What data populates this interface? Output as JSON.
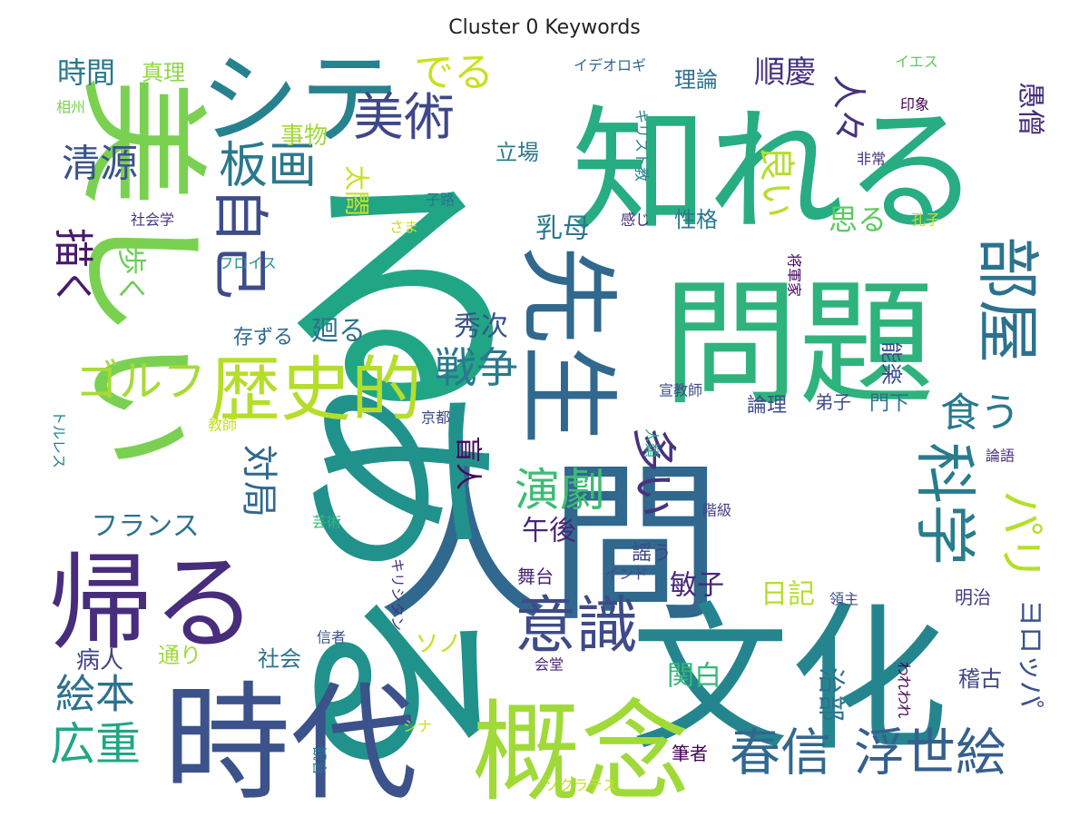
{
  "title": "Cluster 0 Keywords",
  "chart_data": {
    "type": "wordcloud",
    "title": "Cluster 0 Keywords",
    "palette": "viridis",
    "words": [
      {
        "text": "人間",
        "weight": 100,
        "color": "#30688e"
      },
      {
        "text": "る",
        "weight": 96,
        "color": "#21a685"
      },
      {
        "text": "ある",
        "weight": 92,
        "color": "#21918c"
      },
      {
        "text": "文化",
        "weight": 88,
        "color": "#25858e"
      },
      {
        "text": "問題",
        "weight": 86,
        "color": "#2eb37c"
      },
      {
        "text": "知れる",
        "weight": 82,
        "color": "#27ad81"
      },
      {
        "text": "美しい",
        "weight": 80,
        "color": "#7ad151"
      },
      {
        "text": "時代",
        "weight": 76,
        "color": "#3b528b"
      },
      {
        "text": "概念",
        "weight": 72,
        "color": "#a0da39"
      },
      {
        "text": "先生",
        "weight": 66,
        "color": "#31688e"
      },
      {
        "text": "帰る",
        "weight": 64,
        "color": "#472d7b"
      },
      {
        "text": "シテ",
        "weight": 60,
        "color": "#26828e"
      },
      {
        "text": "歴史的",
        "weight": 52,
        "color": "#b5de2b"
      },
      {
        "text": "部屋",
        "weight": 50,
        "color": "#2c728e"
      },
      {
        "text": "科学",
        "weight": 48,
        "color": "#287c8e"
      },
      {
        "text": "意識",
        "weight": 44,
        "color": "#3e4a89"
      },
      {
        "text": "自己",
        "weight": 42,
        "color": "#3e4c8a"
      },
      {
        "text": "春信",
        "weight": 40,
        "color": "#31688e"
      },
      {
        "text": "浮世絵",
        "weight": 40,
        "color": "#355f8d"
      },
      {
        "text": "美術",
        "weight": 40,
        "color": "#3f4788"
      },
      {
        "text": "板画",
        "weight": 38,
        "color": "#2a788e"
      },
      {
        "text": "演劇",
        "weight": 36,
        "color": "#3dbc74"
      },
      {
        "text": "多い",
        "weight": 36,
        "color": "#46337e"
      },
      {
        "text": "パリ",
        "weight": 36,
        "color": "#b5de2b"
      },
      {
        "text": "戦争",
        "weight": 34,
        "color": "#2a788e"
      },
      {
        "text": "広重",
        "weight": 34,
        "color": "#21a685"
      },
      {
        "text": "ゴルフ",
        "weight": 34,
        "color": "#a5db36"
      },
      {
        "text": "でる",
        "weight": 32,
        "color": "#c8e020"
      },
      {
        "text": "食う",
        "weight": 32,
        "color": "#2a788e"
      },
      {
        "text": "絵本",
        "weight": 32,
        "color": "#2c728e"
      },
      {
        "text": "描く",
        "weight": 30,
        "color": "#481a6c"
      },
      {
        "text": "清源",
        "weight": 30,
        "color": "#3b528b"
      },
      {
        "text": "対局",
        "weight": 30,
        "color": "#31688e"
      },
      {
        "text": "良い",
        "weight": 28,
        "color": "#b5de2b"
      },
      {
        "text": "人々",
        "weight": 28,
        "color": "#46327e"
      },
      {
        "text": "順慶",
        "weight": 26,
        "color": "#46337e"
      },
      {
        "text": "時間",
        "weight": 26,
        "color": "#2a788e"
      },
      {
        "text": "愚僧",
        "weight": 26,
        "color": "#472d7b"
      },
      {
        "text": "ヨロッパ",
        "weight": 26,
        "color": "#3b528b"
      },
      {
        "text": "思る",
        "weight": 24,
        "color": "#5ec962"
      },
      {
        "text": "歩く",
        "weight": 24,
        "color": "#6ece58"
      },
      {
        "text": "乳母",
        "weight": 22,
        "color": "#2a788e"
      },
      {
        "text": "フランス",
        "weight": 22,
        "color": "#2c728e"
      },
      {
        "text": "午後",
        "weight": 22,
        "color": "#482677"
      },
      {
        "text": "敏子",
        "weight": 22,
        "color": "#482878"
      },
      {
        "text": "日記",
        "weight": 22,
        "color": "#b5de2b"
      },
      {
        "text": "関白",
        "weight": 22,
        "color": "#35b779"
      },
      {
        "text": "治部",
        "weight": 22,
        "color": "#2c728e"
      },
      {
        "text": "盲人",
        "weight": 22,
        "color": "#46085c"
      },
      {
        "text": "廻る",
        "weight": 22,
        "color": "#2c728e"
      },
      {
        "text": "秀次",
        "weight": 22,
        "color": "#3b528b"
      },
      {
        "text": "太閤",
        "weight": 20,
        "color": "#c8e020"
      },
      {
        "text": "事物",
        "weight": 20,
        "color": "#a0da39"
      },
      {
        "text": "真理",
        "weight": 19,
        "color": "#8fd744"
      },
      {
        "text": "性格",
        "weight": 19,
        "color": "#2a788e"
      },
      {
        "text": "立場",
        "weight": 19,
        "color": "#2a788e"
      },
      {
        "text": "理論",
        "weight": 19,
        "color": "#2c728e"
      },
      {
        "text": "能楽",
        "weight": 19,
        "color": "#3e4c8a"
      },
      {
        "text": "稽古",
        "weight": 19,
        "color": "#404688"
      },
      {
        "text": "ソノ",
        "weight": 19,
        "color": "#c8e020"
      },
      {
        "text": "存ずる",
        "weight": 18,
        "color": "#31688e"
      },
      {
        "text": "病人",
        "weight": 18,
        "color": "#404688"
      },
      {
        "text": "社会",
        "weight": 18,
        "color": "#2c728e"
      },
      {
        "text": "通り",
        "weight": 18,
        "color": "#a0da39"
      },
      {
        "text": "論理",
        "weight": 17,
        "color": "#3e4c8a"
      },
      {
        "text": "門下",
        "weight": 17,
        "color": "#2c728e"
      },
      {
        "text": "弟子",
        "weight": 16,
        "color": "#3e4a89"
      },
      {
        "text": "謡う",
        "weight": 16,
        "color": "#404688"
      },
      {
        "text": "舞台",
        "weight": 16,
        "color": "#482475"
      },
      {
        "text": "明治",
        "weight": 16,
        "color": "#433e85"
      },
      {
        "text": "筆者",
        "weight": 16,
        "color": "#440154"
      },
      {
        "text": "相州",
        "weight": 15,
        "color": "#7ad151"
      },
      {
        "text": "イエス",
        "weight": 15,
        "color": "#5ec962"
      },
      {
        "text": "イデオロギ",
        "weight": 15,
        "color": "#31688e"
      },
      {
        "text": "キリスト教",
        "weight": 15,
        "color": "#26828e"
      },
      {
        "text": "印象",
        "weight": 15,
        "color": "#440154"
      },
      {
        "text": "非常",
        "weight": 15,
        "color": "#46327e"
      },
      {
        "text": "孔子",
        "weight": 15,
        "color": "#c8e020"
      },
      {
        "text": "将軍家",
        "weight": 15,
        "color": "#46085c"
      },
      {
        "text": "子路",
        "weight": 15,
        "color": "#2c728e"
      },
      {
        "text": "社会学",
        "weight": 15,
        "color": "#46337e"
      },
      {
        "text": "さま",
        "weight": 15,
        "color": "#c8e020"
      },
      {
        "text": "感じ",
        "weight": 15,
        "color": "#482475"
      },
      {
        "text": "フロイス",
        "weight": 15,
        "color": "#21918c"
      },
      {
        "text": "トルレス",
        "weight": 15,
        "color": "#26828e"
      },
      {
        "text": "教師",
        "weight": 15,
        "color": "#c8e020"
      },
      {
        "text": "京都",
        "weight": 15,
        "color": "#3e4a89"
      },
      {
        "text": "宣教師",
        "weight": 15,
        "color": "#3e4c8a"
      },
      {
        "text": "人類",
        "weight": 15,
        "color": "#21a685"
      },
      {
        "text": "論語",
        "weight": 15,
        "color": "#46327e"
      },
      {
        "text": "芸術",
        "weight": 15,
        "color": "#35b779"
      },
      {
        "text": "階級",
        "weight": 15,
        "color": "#433e85"
      },
      {
        "text": "インド",
        "weight": 15,
        "color": "#3e4c8a"
      },
      {
        "text": "キリシタン",
        "weight": 15,
        "color": "#46337e"
      },
      {
        "text": "領主",
        "weight": 15,
        "color": "#3e4c8a"
      },
      {
        "text": "われわれ",
        "weight": 15,
        "color": "#440154"
      },
      {
        "text": "信者",
        "weight": 15,
        "color": "#3b528b"
      },
      {
        "text": "会堂",
        "weight": 15,
        "color": "#482475"
      },
      {
        "text": "シナ",
        "weight": 15,
        "color": "#c8e020"
      },
      {
        "text": "観音",
        "weight": 15,
        "color": "#2c728e"
      },
      {
        "text": "ソクラテス",
        "weight": 15,
        "color": "#c8e020"
      }
    ]
  }
}
